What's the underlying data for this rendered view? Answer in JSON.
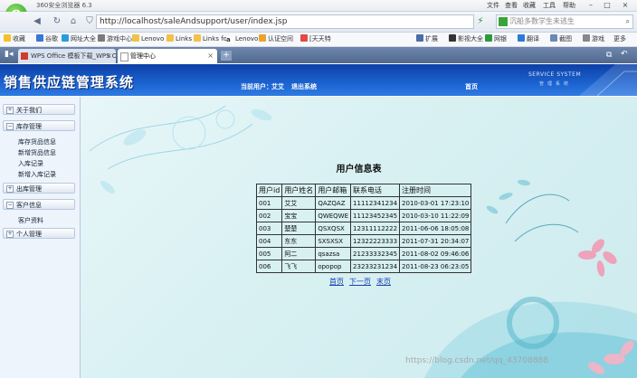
{
  "browser": {
    "app_name": "360安全浏览器 6.3",
    "menu": [
      "文件",
      "查看",
      "收藏",
      "工具",
      "帮助"
    ],
    "url": "http://localhost/saleAndsupport/user/index.jsp",
    "search_placeholder": "沉船多数学生未逃生",
    "bookmarks": [
      "收藏",
      "谷歌",
      "网址大全",
      "游戏中心",
      "Lenovo",
      "Links",
      "Links for",
      "Lenovo",
      "认证空间",
      "[天天特"
    ],
    "bookmark_right": [
      "扩展",
      "影视大全",
      "网银",
      "翻译",
      "截图",
      "游戏",
      "更多"
    ],
    "tabs": [
      "WPS Office 模板下载_WPS O",
      "管理中心"
    ]
  },
  "app": {
    "title": "销售供应链管理系统",
    "current_user_label": "当前用户：",
    "current_user": "艾艾",
    "logout": "退出系统",
    "home": "首页",
    "service_system": "SERVICE SYSTEM",
    "service_sub": "管理系统"
  },
  "sidebar": {
    "sections": [
      {
        "label": "关于我们",
        "items": []
      },
      {
        "label": "库存管理",
        "items": [
          "库存货品信息",
          "新增货品信息",
          "入库记录",
          "新增入库记录"
        ]
      },
      {
        "label": "出库管理",
        "items": []
      },
      {
        "label": "客户信息",
        "items": [
          "客户资料"
        ]
      },
      {
        "label": "个人管理",
        "items": []
      }
    ]
  },
  "main": {
    "heading": "用户信息表",
    "columns": [
      "用户id",
      "用户姓名",
      "用户邮箱",
      "联系电话",
      "注册时间"
    ],
    "rows": [
      [
        "001",
        "艾艾",
        "QAZQAZ",
        "11112341234",
        "2010-03-01 17:23:10"
      ],
      [
        "002",
        "宝宝",
        "QWEQWE",
        "11123452345",
        "2010-03-10 11:22:09"
      ],
      [
        "003",
        "楚楚",
        "QSXQSX",
        "12311112222",
        "2011-06-06 18:05:08"
      ],
      [
        "004",
        "东东",
        "SXSXSX",
        "12322223333",
        "2011-07-31 20:34:07"
      ],
      [
        "005",
        "阿二",
        "qsazsa",
        "21233332345",
        "2011-08-02 09:46:06"
      ],
      [
        "006",
        "飞飞",
        "opopop",
        "23233231234",
        "2011-08-23 06:23:05"
      ]
    ],
    "pager": [
      "首页",
      "下一页",
      "末页"
    ]
  },
  "watermark": "https://blog.csdn.net/qq_43708888"
}
